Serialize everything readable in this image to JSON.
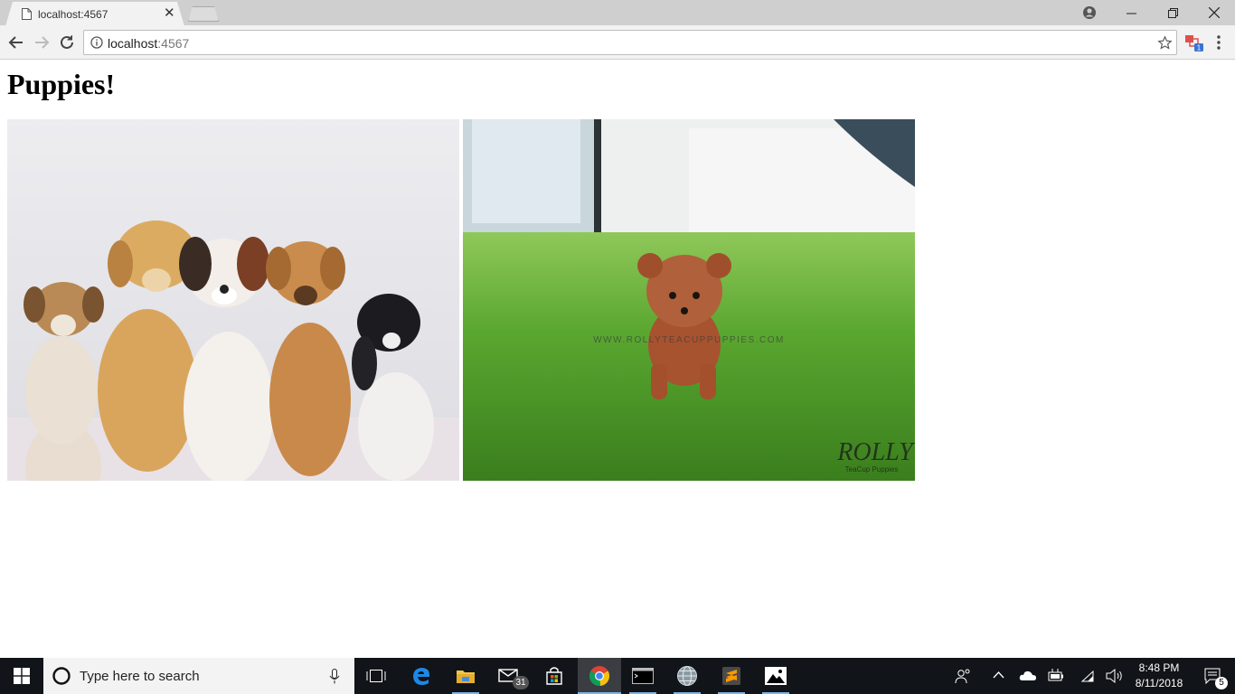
{
  "browser": {
    "tab_title": "localhost:4567",
    "url_host": "localhost",
    "url_port": ":4567"
  },
  "page": {
    "heading": "Puppies!",
    "images": [
      {
        "alt": "Five puppies sitting in a row"
      },
      {
        "alt": "Small brown teacup poodle puppy on grass"
      }
    ],
    "watermark": "WWW.ROLLYTEACUPPUPPIES.COM",
    "logo_main": "ROLLY",
    "logo_sub": "TeaCup Puppies"
  },
  "taskbar": {
    "search_placeholder": "Type here to search",
    "mail_badge": "31",
    "time": "8:48 PM",
    "date": "8/11/2018",
    "notification_badge": "5"
  },
  "colors": {
    "accent": "#7fb2e8",
    "taskbar_bg": "#111418",
    "grass": "#4d9a2a"
  }
}
